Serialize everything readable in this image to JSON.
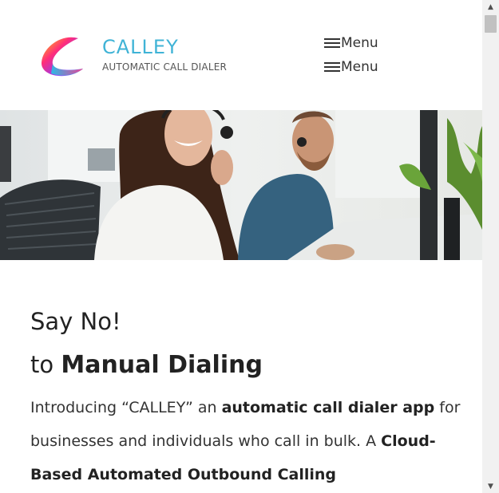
{
  "header": {
    "logo": {
      "name": "CALLEY",
      "tagline": "AUTOMATIC CALL DIALER"
    },
    "menus": [
      {
        "label": "Menu"
      },
      {
        "label": "Menu"
      }
    ]
  },
  "hero": {
    "icon": "hero-photo-call-center-agents"
  },
  "main": {
    "headline": "Say No!",
    "subheadline": {
      "prefix": "to ",
      "strong": "Manual Dialing"
    },
    "intro": {
      "p1": "Introducing “CALLEY” an ",
      "b1": "automatic call dialer app",
      "p2": " for businesses and individuals who call in bulk. A ",
      "b2": "Cloud-Based Automated Outbound Calling"
    }
  },
  "scrollbar": {
    "up_icon": "scroll-up-arrow-icon",
    "down_icon": "scroll-down-arrow-icon"
  },
  "colors": {
    "brand": "#3fb3d6",
    "text": "#333333",
    "heading": "#222222"
  }
}
